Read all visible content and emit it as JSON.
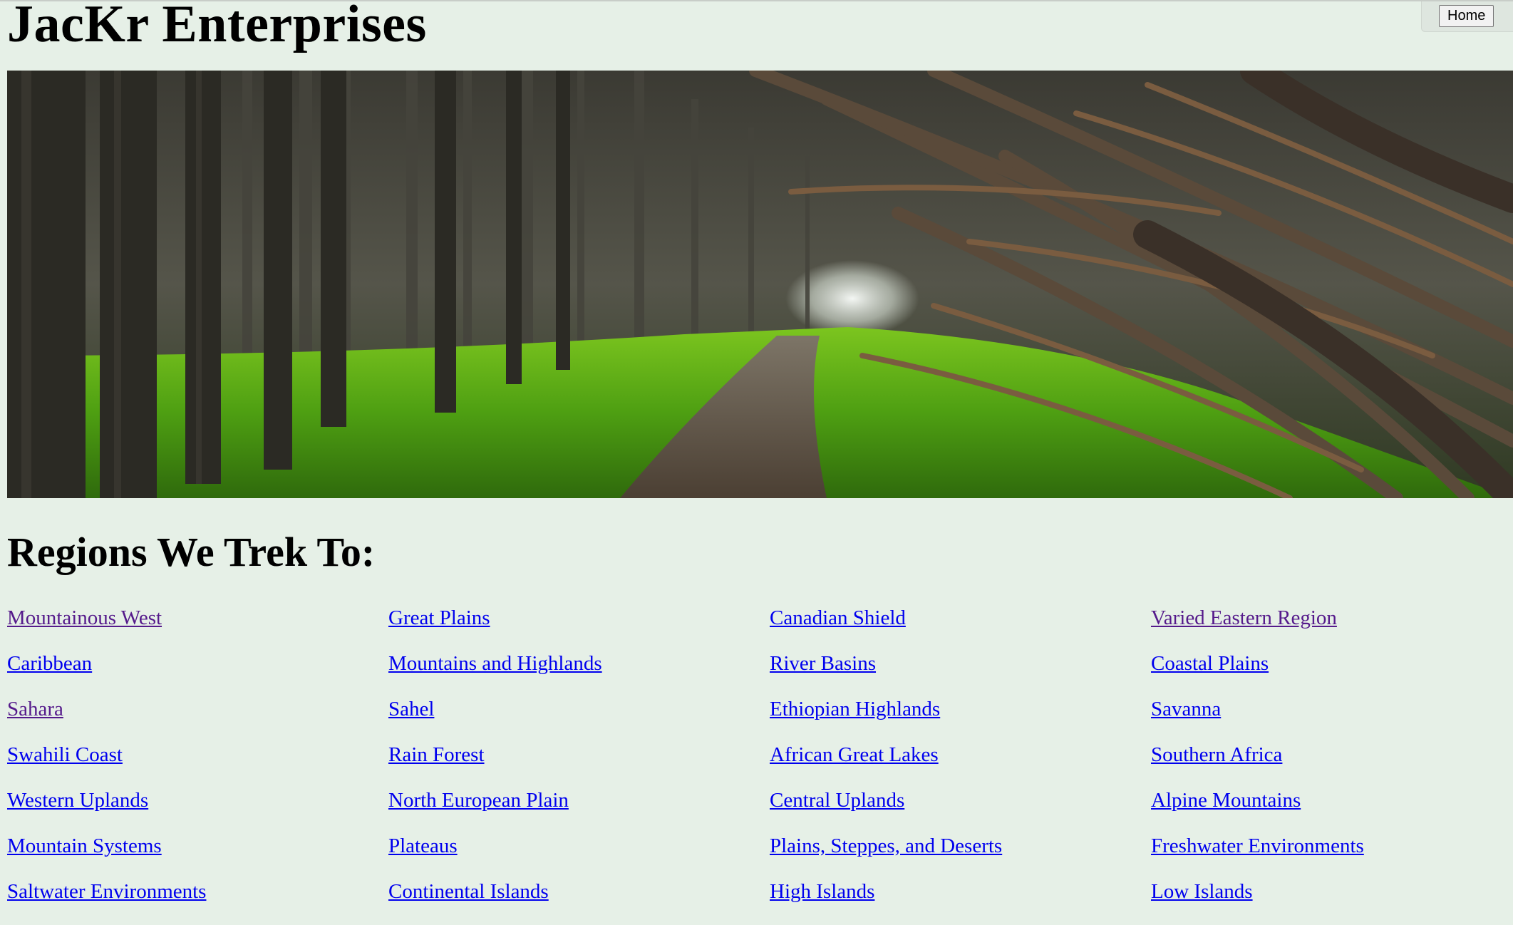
{
  "site": {
    "title": "JacKr Enterprises"
  },
  "nav": {
    "home_label": "Home"
  },
  "hero": {
    "alt": "Forest path beneath arching cypress trees"
  },
  "regions": {
    "heading": "Regions We Trek To:",
    "links": [
      {
        "label": "Mountainous West",
        "visited": true
      },
      {
        "label": "Great Plains",
        "visited": false
      },
      {
        "label": "Canadian Shield",
        "visited": false
      },
      {
        "label": "Varied Eastern Region",
        "visited": true
      },
      {
        "label": "Caribbean",
        "visited": false
      },
      {
        "label": "Mountains and Highlands",
        "visited": false
      },
      {
        "label": "River Basins",
        "visited": false
      },
      {
        "label": "Coastal Plains",
        "visited": false
      },
      {
        "label": "Sahara",
        "visited": true
      },
      {
        "label": "Sahel",
        "visited": false
      },
      {
        "label": "Ethiopian Highlands",
        "visited": false
      },
      {
        "label": "Savanna",
        "visited": false
      },
      {
        "label": "Swahili Coast",
        "visited": false
      },
      {
        "label": "Rain Forest",
        "visited": false
      },
      {
        "label": "African Great Lakes",
        "visited": false
      },
      {
        "label": "Southern Africa",
        "visited": false
      },
      {
        "label": "Western Uplands",
        "visited": false
      },
      {
        "label": "North European Plain",
        "visited": false
      },
      {
        "label": "Central Uplands",
        "visited": false
      },
      {
        "label": "Alpine Mountains",
        "visited": false
      },
      {
        "label": "Mountain Systems",
        "visited": false
      },
      {
        "label": "Plateaus",
        "visited": false
      },
      {
        "label": "Plains, Steppes, and Deserts",
        "visited": false
      },
      {
        "label": "Freshwater Environments",
        "visited": false
      },
      {
        "label": "Saltwater Environments",
        "visited": false
      },
      {
        "label": "Continental Islands",
        "visited": false
      },
      {
        "label": "High Islands",
        "visited": false
      },
      {
        "label": "Low Islands",
        "visited": false
      }
    ]
  },
  "colors": {
    "background": "#e6f0e7",
    "link": "#0000ee",
    "link_visited": "#551a8b"
  }
}
